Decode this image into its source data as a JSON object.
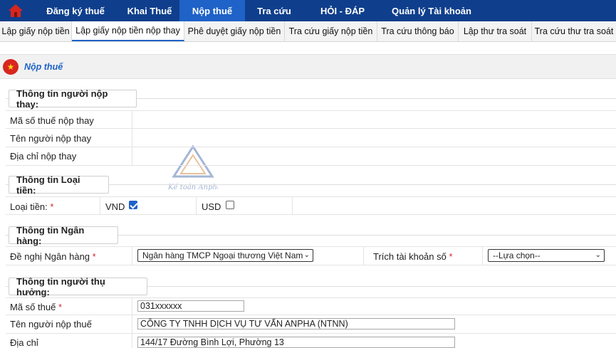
{
  "topnav": {
    "items": [
      {
        "label": "Đăng ký thuế"
      },
      {
        "label": "Khai Thuế"
      },
      {
        "label": "Nộp thuế"
      },
      {
        "label": "Tra cứu"
      },
      {
        "label": "HỎI - ĐÁP"
      },
      {
        "label": "Quản lý Tài khoản"
      }
    ],
    "active_color": "#1f62c8",
    "bar_color": "#0f3f8c"
  },
  "subnav": {
    "items": [
      {
        "label": "Lập giấy nộp tiền"
      },
      {
        "label": "Lập giấy nộp tiền nộp thay"
      },
      {
        "label": "Phê duyệt giấy nộp tiền"
      },
      {
        "label": "Tra cứu giấy nộp tiền"
      },
      {
        "label": "Tra cứu thông báo"
      },
      {
        "label": "Lập thư tra soát"
      },
      {
        "label": "Tra cứu thư tra soát"
      }
    ]
  },
  "page": {
    "title": "Nộp thuế"
  },
  "watermark": {
    "text": "Kế toán Anpha"
  },
  "payer_section": {
    "title": "Thông tin người nộp thay:",
    "tax_code_label": "Mã số thuế nộp thay",
    "name_label": "Tên người nộp thay",
    "address_label": "Địa chỉ nộp thay"
  },
  "currency_section": {
    "title": "Thông tin Loại tiền:",
    "currency_label": "Loại tiền:",
    "required_mark": "*",
    "vnd_label": "VND",
    "vnd_checked": true,
    "usd_label": "USD",
    "usd_checked": false
  },
  "bank_section": {
    "title": "Thông tin Ngân hàng:",
    "bank_label": "Đề nghị Ngân hàng",
    "required_mark": "*",
    "bank_value": "Ngân hàng TMCP Ngoại thương Việt Nam",
    "account_label": "Trích tài khoản số",
    "account_value": "--Lựa chọn--"
  },
  "beneficiary_section": {
    "title": "Thông tin người thụ hưởng:",
    "tax_code_label": "Mã số thuế",
    "required_mark": "*",
    "tax_code_value": "031xxxxxx",
    "name_label": "Tên người nộp thuế",
    "name_value": "CÔNG TY TNHH DỊCH VỤ TƯ VẤN ANPHA (NTNN)",
    "address_label": "Địa chỉ",
    "address_value": "144/17 Đường Bình Lợi, Phường 13"
  }
}
